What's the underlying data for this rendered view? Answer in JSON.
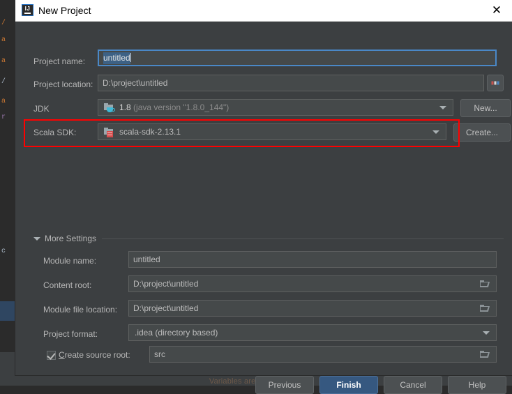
{
  "window": {
    "title": "New Project",
    "app_icon": "intellij-idea-icon",
    "close_icon": "close-icon"
  },
  "form": {
    "project_name": {
      "label": "Project name:",
      "value": "untitled",
      "selected": true,
      "focused": true
    },
    "project_location": {
      "label": "Project location:",
      "value": "D:\\project\\untitled",
      "browse_label": "browse-ellipsis"
    },
    "jdk": {
      "label": "JDK",
      "value_main": "1.8",
      "value_detail": "(java version \"1.8.0_144\")",
      "icon": "java-folder-icon",
      "button": "New..."
    },
    "scala_sdk": {
      "label": "Scala SDK:",
      "value": "scala-sdk-2.13.1",
      "icon": "scala-folder-icon",
      "button": "Create...",
      "highlighted": true,
      "highlight_color": "#ff0000"
    }
  },
  "more_settings": {
    "label": "More Settings",
    "expanded": true,
    "module_name": {
      "label": "Module name:",
      "value": "untitled"
    },
    "content_root": {
      "label": "Content root:",
      "value": "D:\\project\\untitled"
    },
    "module_file_location": {
      "label": "Module file location:",
      "value": "D:\\project\\untitled"
    },
    "project_format": {
      "label": "Project format:",
      "value": ".idea (directory based)"
    },
    "create_source_root": {
      "label_mnemonic": "C",
      "label_rest": "reate source root:",
      "checked": true,
      "value": "src"
    }
  },
  "footer": {
    "previous": "Previous",
    "finish": "Finish",
    "cancel": "Cancel",
    "help": "Help",
    "default_button": "Finish",
    "default_color": "#365880"
  },
  "ide_background": {
    "status_text": "Variables are not available",
    "code_fragments": [
      "/",
      "a",
      "a",
      "/",
      "a",
      "r",
      "c"
    ]
  }
}
